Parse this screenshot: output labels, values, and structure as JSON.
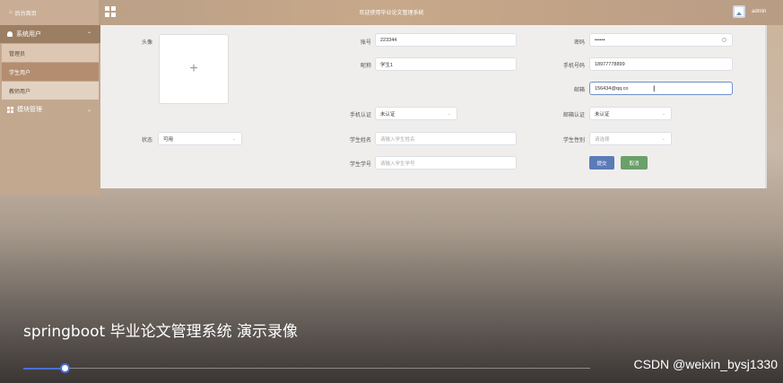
{
  "header": {
    "home_label": "后台首页",
    "title": "欢迎使用毕业论文管理系统",
    "user": "admin"
  },
  "sidebar": {
    "groups": [
      {
        "label": "系统用户",
        "items": [
          "管理员",
          "学生用户",
          "教师用户"
        ]
      },
      {
        "label": "模块管理"
      }
    ]
  },
  "form": {
    "avatar_label": "头像",
    "upload_symbol": "+",
    "account_label": "账号",
    "account_value": "223344",
    "password_label": "密码",
    "password_value": "••••••",
    "nickname_label": "昵称",
    "nickname_value": "学生1",
    "phone_label": "手机号码",
    "phone_value": "18977778899",
    "email_label": "邮箱",
    "email_value": "156434@qq.co",
    "phone_verify_label": "手机认证",
    "phone_verify_value": "未认证",
    "email_verify_label": "邮箱认证",
    "email_verify_value": "未认证",
    "status_label": "状态",
    "status_value": "可用",
    "student_name_label": "学生姓名",
    "student_name_placeholder": "请输入学生姓名",
    "gender_label": "学生性别",
    "gender_placeholder": "请选择",
    "student_no_label": "学生学号",
    "student_no_placeholder": "请输入学生学号",
    "submit_label": "提交",
    "cancel_label": "取消"
  },
  "colors": {
    "submit": "#5b7bb8",
    "cancel": "#6aa06a",
    "selected_menu": "#b48d70"
  },
  "video": {
    "caption": "springboot 毕业论文管理系统 演示录像",
    "watermark": "CSDN @weixin_bysj1330",
    "progress": 0.08
  }
}
